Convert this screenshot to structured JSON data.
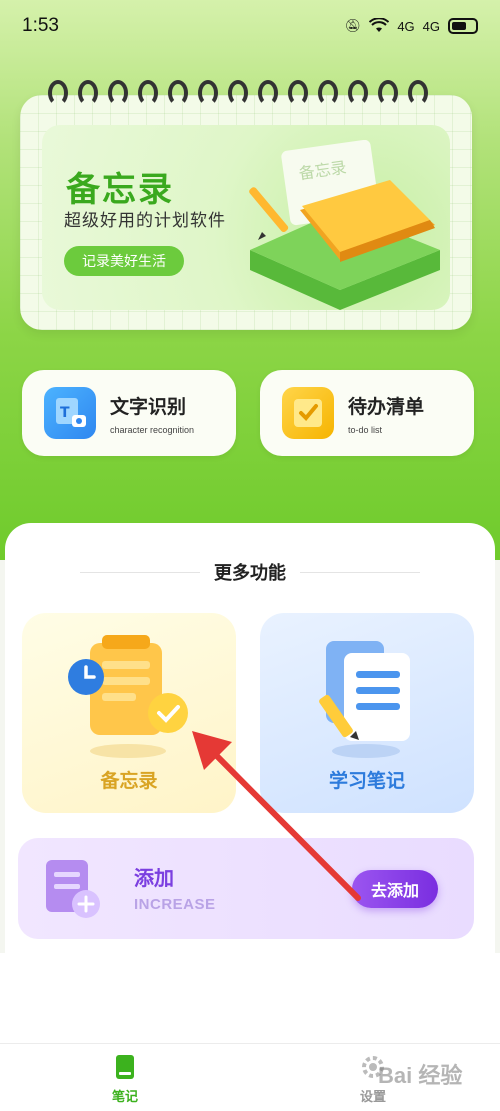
{
  "status_bar": {
    "time": "1:53",
    "signal1": "4G",
    "signal2": "4G"
  },
  "hero": {
    "title": "备忘录",
    "subtitle": "超级好用的计划软件",
    "button": "记录美好生活",
    "illustration_note": "备忘录"
  },
  "quick_cards": [
    {
      "title": "文字识别",
      "subtitle": "character recognition",
      "icon": "text-recognition-icon"
    },
    {
      "title": "待办清单",
      "subtitle": "to-do list",
      "icon": "todo-icon"
    }
  ],
  "more": {
    "title": "更多功能",
    "features": [
      {
        "label": "备忘录",
        "icon": "memo-clipboard-icon"
      },
      {
        "label": "学习笔记",
        "icon": "study-notes-icon"
      }
    ],
    "add": {
      "title": "添加",
      "subtitle": "INCREASE",
      "button": "去添加"
    }
  },
  "tabbar": {
    "tabs": [
      {
        "label": "笔记"
      },
      {
        "label": "设置"
      }
    ]
  },
  "watermark": "Bai 经验",
  "colors": {
    "accent_green": "#3cb21e",
    "purple": "#7b3fe0",
    "arrow_red": "#e53935"
  }
}
